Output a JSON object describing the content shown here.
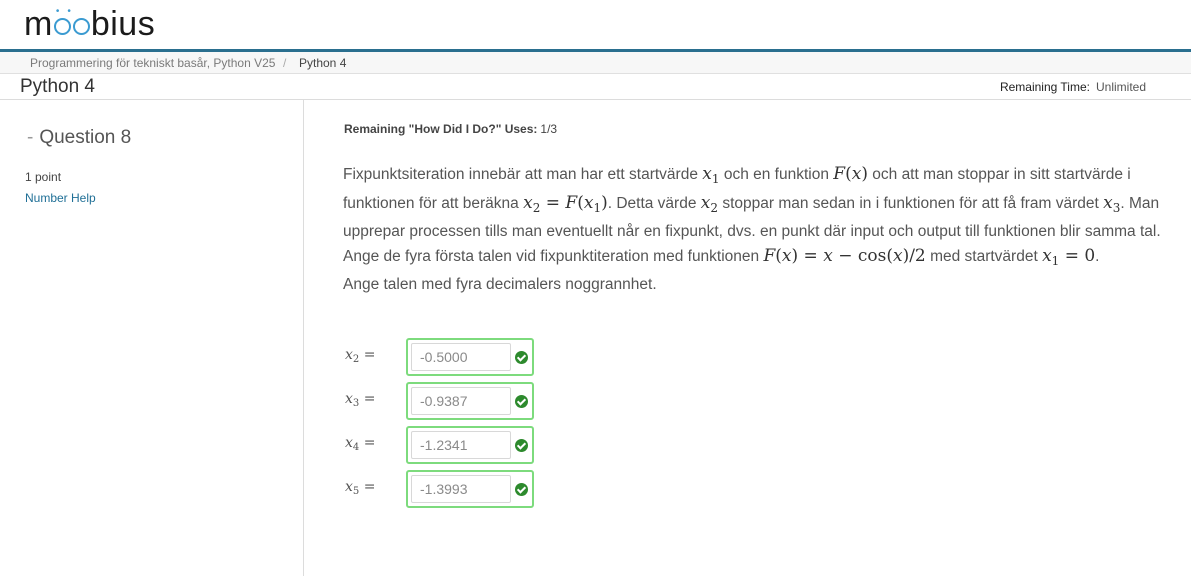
{
  "header": {
    "logo_text": "möbius"
  },
  "breadcrumb": {
    "course": "Programmering för tekniskt basår, Python V25",
    "separator": "/",
    "current": "Python 4"
  },
  "titlebar": {
    "title": "Python 4",
    "remaining_time_label": "Remaining Time:",
    "remaining_time_value": "Unlimited"
  },
  "sidebar": {
    "question_title": "Question 8",
    "points": "1 point",
    "help_link": "Number Help"
  },
  "main": {
    "remaining_label": "Remaining \"How Did I Do?\" Uses:",
    "remaining_count": "1/3",
    "paragraphs": [
      "Fixpunktsiteration innebär att man har ett startvärde",
      "och en funktion",
      "och att man stoppar in sitt startvärde i funktionen för att beräkna",
      ". Detta värde",
      "stoppar man sedan in i funktionen för att få fram värdet",
      ". Man upprepar processen tills man eventuellt når en fixpunkt, dvs. en punkt där input och output till funktionen blir samma tal.",
      "Ange de fyra första talen vid fixpunktiteration med funktionen",
      "med startvärdet",
      ".",
      "Ange talen med fyra decimalers noggrannhet."
    ],
    "answers": [
      {
        "label": "x",
        "sub": "2",
        "value": "-0.5000"
      },
      {
        "label": "x",
        "sub": "3",
        "value": "-0.9387"
      },
      {
        "label": "x",
        "sub": "4",
        "value": "-1.2341"
      },
      {
        "label": "x",
        "sub": "5",
        "value": "-1.3993"
      }
    ]
  },
  "colors": {
    "accent": "#2a6f8f",
    "logo_ring": "#3b9bd1",
    "link": "#1f6f96",
    "correct_border": "#7ddb7d",
    "check": "#2d8a2d"
  }
}
